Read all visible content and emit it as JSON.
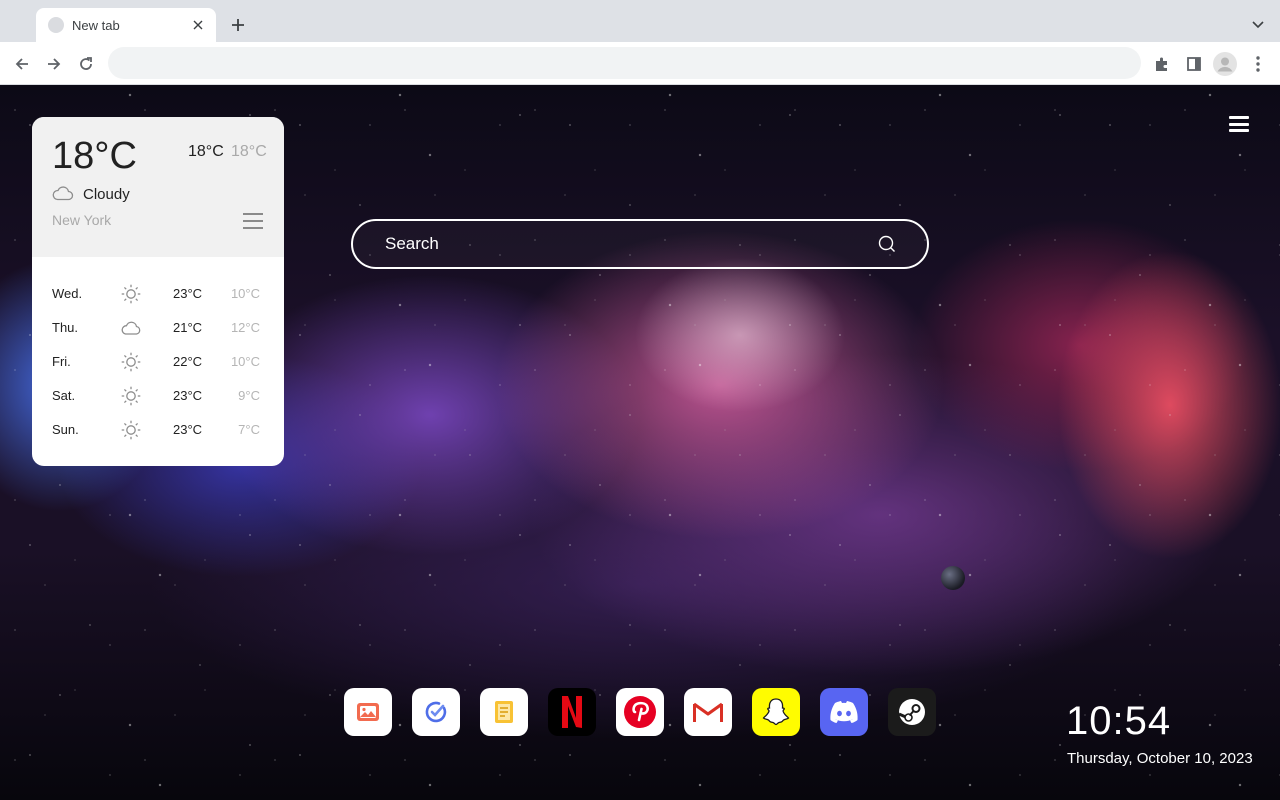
{
  "browser": {
    "tab_title": "New tab",
    "omnibox_value": "",
    "colors": {
      "tabstrip": "#dee1e6",
      "toolbar": "#ffffff",
      "omnibox": "#f1f3f4"
    }
  },
  "weather": {
    "current_temp": "18°C",
    "high": "18°C",
    "low": "18°C",
    "condition": "Cloudy",
    "condition_icon": "cloud-icon",
    "city": "New York",
    "forecast": [
      {
        "day": "Wed.",
        "icon": "sun-icon",
        "high": "23°C",
        "low": "10°C"
      },
      {
        "day": "Thu.",
        "icon": "cloud-icon",
        "high": "21°C",
        "low": "12°C"
      },
      {
        "day": "Fri.",
        "icon": "sun-icon",
        "high": "22°C",
        "low": "10°C"
      },
      {
        "day": "Sat.",
        "icon": "sun-icon",
        "high": "23°C",
        "low": "9°C"
      },
      {
        "day": "Sun.",
        "icon": "sun-icon",
        "high": "23°C",
        "low": "7°C"
      }
    ]
  },
  "search": {
    "placeholder": "Search"
  },
  "dock": {
    "apps": [
      {
        "name": "photos",
        "icon": "image-icon",
        "bg": "#ffffff"
      },
      {
        "name": "tasks",
        "icon": "check-icon",
        "bg": "#ffffff"
      },
      {
        "name": "notes",
        "icon": "note-icon",
        "bg": "#ffffff"
      },
      {
        "name": "netflix",
        "icon": "netflix-icon",
        "bg": "#000000"
      },
      {
        "name": "pinterest",
        "icon": "pinterest-icon",
        "bg": "#ffffff"
      },
      {
        "name": "gmail",
        "icon": "gmail-icon",
        "bg": "#ffffff"
      },
      {
        "name": "snapchat",
        "icon": "snapchat-icon",
        "bg": "#fffc00"
      },
      {
        "name": "discord",
        "icon": "discord-icon",
        "bg": "#5865f2"
      },
      {
        "name": "steam",
        "icon": "steam-icon",
        "bg": "#1b1b1b"
      }
    ]
  },
  "clock": {
    "time": "10:54",
    "date": "Thursday, October 10, 2023"
  }
}
